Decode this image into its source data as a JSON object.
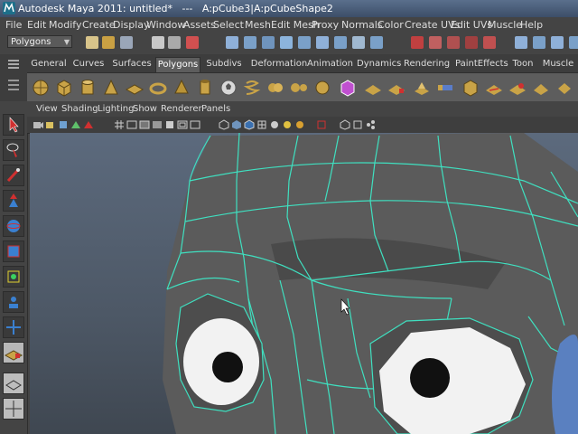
{
  "window": {
    "title": "Autodesk Maya 2011: untitled*   ---   A:pCube3|A:pCubeShape2"
  },
  "menus": [
    {
      "label": "File"
    },
    {
      "label": "Edit"
    },
    {
      "label": "Modify"
    },
    {
      "label": "Create"
    },
    {
      "label": "Display"
    },
    {
      "label": "Window"
    },
    {
      "label": "Assets"
    },
    {
      "label": "Select"
    },
    {
      "label": "Mesh"
    },
    {
      "label": "Edit Mesh"
    },
    {
      "label": "Proxy"
    },
    {
      "label": "Normals"
    },
    {
      "label": "Color"
    },
    {
      "label": "Create UVs"
    },
    {
      "label": "Edit UVs"
    },
    {
      "label": "Muscle"
    },
    {
      "label": "Help"
    }
  ],
  "status_line": {
    "mode_selector": "Polygons"
  },
  "shelf_tabs": [
    {
      "label": "General",
      "active": false
    },
    {
      "label": "Curves",
      "active": false
    },
    {
      "label": "Surfaces",
      "active": false
    },
    {
      "label": "Polygons",
      "active": true
    },
    {
      "label": "Subdivs",
      "active": false
    },
    {
      "label": "Deformation",
      "active": false
    },
    {
      "label": "Animation",
      "active": false
    },
    {
      "label": "Dynamics",
      "active": false
    },
    {
      "label": "Rendering",
      "active": false
    },
    {
      "label": "PaintEffects",
      "active": false
    },
    {
      "label": "Toon",
      "active": false
    },
    {
      "label": "Muscle",
      "active": false
    }
  ],
  "panel_menus": [
    {
      "label": "View"
    },
    {
      "label": "Shading"
    },
    {
      "label": "Lighting"
    },
    {
      "label": "Show"
    },
    {
      "label": "Renderer"
    },
    {
      "label": "Panels"
    }
  ],
  "colors": {
    "wireframe": "#3fe0c0",
    "mesh": "#5b5b5b",
    "viewport_top": "#5c6a7d",
    "viewport_bottom": "#3f4751",
    "active_tab": "#5d5d5d"
  }
}
